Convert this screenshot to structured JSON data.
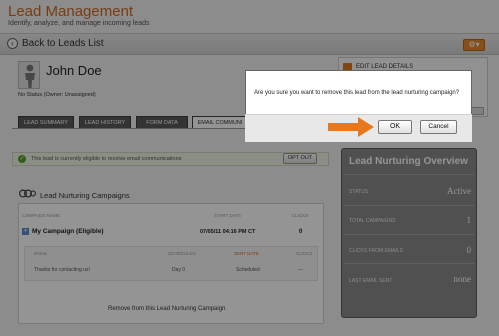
{
  "header": {
    "title": "Lead Management",
    "subtitle": "Identify, analyze, and manage incoming leads",
    "back_label": "Back to Leads List",
    "gear_icon": "gear-icon"
  },
  "contact": {
    "name": "John Doe",
    "status_line": "No Status (Owner: Unassigned)"
  },
  "edit_box": {
    "edit_label": "EDIT LEAD DETAILS"
  },
  "tabs": [
    {
      "label": "LEAD SUMMARY"
    },
    {
      "label": "LEAD HISTORY"
    },
    {
      "label": "FORM DATA"
    },
    {
      "label": "EMAIL COMMUNI"
    }
  ],
  "eligibility": {
    "message": "This lead is currently eligible to receive email communications",
    "opt_out_label": "OPT OUT"
  },
  "campaigns": {
    "title": "Lead Nurturing Campaigns",
    "headers": {
      "name": "CAMPAIGN NAME",
      "start": "START DATE",
      "clicks": "CLICKS"
    },
    "row": {
      "name": "My Campaign (Eligible)",
      "start": "07/05/11 04:16 PM CT",
      "clicks": "0"
    },
    "sub_headers": {
      "email": "EMAIL",
      "scheduled": "SCHEDULED",
      "sent": "SENT DATE",
      "clicks": "CLICKS"
    },
    "sub_row": {
      "email": "Thanks for contacting us!",
      "scheduled": "Day 0",
      "sent": "Scheduled",
      "clicks": "---"
    },
    "remove_label": "Remove from this Lead Nurturing Campaign"
  },
  "overview": {
    "title": "Lead Nurturing Overview",
    "rows": [
      {
        "label": "STATUS",
        "value": "Active"
      },
      {
        "label": "TOTAL CAMPAIGNS",
        "value": "1"
      },
      {
        "label": "CLICKS FROM EMAILS",
        "value": "0"
      },
      {
        "label": "LAST EMAIL SENT",
        "value": "none"
      }
    ]
  },
  "modal": {
    "message": "Are you sure you want to remove this lead from the lead nurturing campaign?",
    "ok_label": "OK",
    "cancel_label": "Cancel"
  },
  "colors": {
    "accent": "#d2691e",
    "arrow": "#e8781e",
    "overlay": "#000000"
  }
}
